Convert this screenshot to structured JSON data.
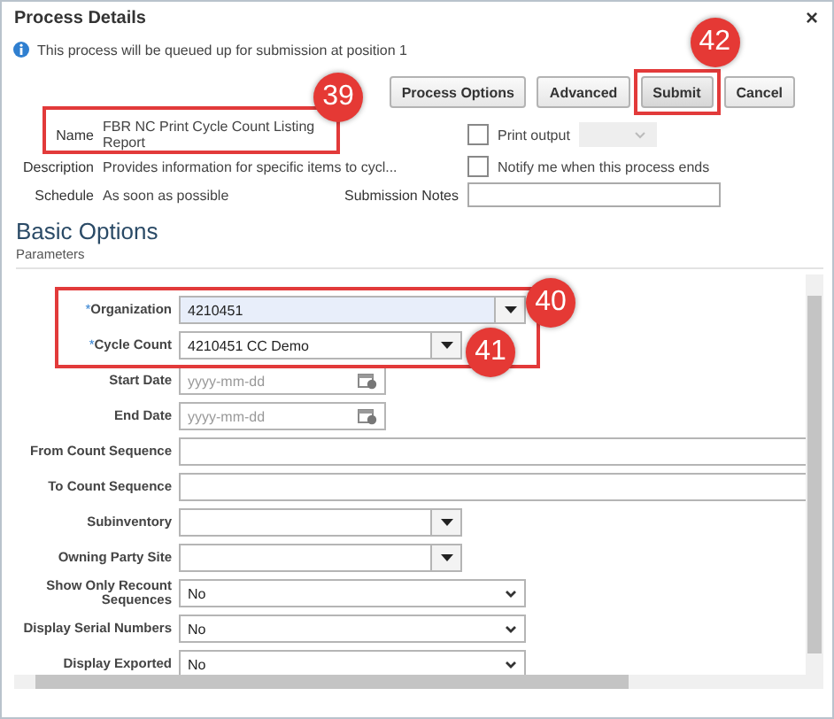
{
  "window": {
    "title": "Process Details",
    "close": "×"
  },
  "info": "This process will be queued up for submission at position 1",
  "buttons": [
    {
      "label": "Process Options",
      "kind": "normal"
    },
    {
      "label": "Advanced",
      "kind": "normal"
    },
    {
      "label": "Submit",
      "kind": "primary"
    },
    {
      "label": "Cancel",
      "kind": "normal"
    }
  ],
  "details": {
    "name_label": "Name",
    "name": "FBR NC Print Cycle Count Listing Report",
    "description_label": "Description",
    "description": "Provides information for specific items to cycl...",
    "schedule_label": "Schedule",
    "schedule": "As soon as possible",
    "notes_label": "Submission Notes"
  },
  "options": [
    {
      "label": "Print output",
      "checked": false,
      "kind": "with-select"
    },
    {
      "label": "Notify me when this process ends",
      "checked": false,
      "kind": "plain"
    }
  ],
  "section": {
    "title": "Basic Options",
    "subtitle": "Parameters"
  },
  "parameters": [
    {
      "label": "Organization",
      "marker": "*",
      "kind": "combo",
      "value": "4210451",
      "focused": true
    },
    {
      "label": "Cycle Count",
      "marker": "*",
      "kind": "lov",
      "value": "4210451 CC Demo",
      "focused": false
    },
    {
      "label": "Start Date",
      "kind": "date",
      "placeholder": "yyyy-mm-dd",
      "focused": false
    },
    {
      "label": "End Date",
      "kind": "date",
      "placeholder": "yyyy-mm-dd",
      "focused": false
    },
    {
      "label": "From Count Sequence",
      "kind": "text",
      "focused": false
    },
    {
      "label": "To Count Sequence",
      "kind": "text",
      "focused": false
    },
    {
      "label": "Subinventory",
      "kind": "lov",
      "focused": false
    },
    {
      "label": "Owning Party Site",
      "kind": "lov",
      "focused": false
    },
    {
      "label": "Show Only Recount Sequences",
      "kind": "choice",
      "value": "No",
      "focused": false
    },
    {
      "label": "Display Serial Numbers",
      "kind": "choice",
      "value": "No",
      "focused": false
    },
    {
      "label": "Display Exported",
      "kind": "choice",
      "value": "No",
      "focused": false
    }
  ],
  "annotations": [
    {
      "label": "39"
    },
    {
      "label": "40"
    },
    {
      "label": "41"
    },
    {
      "label": "42"
    }
  ]
}
